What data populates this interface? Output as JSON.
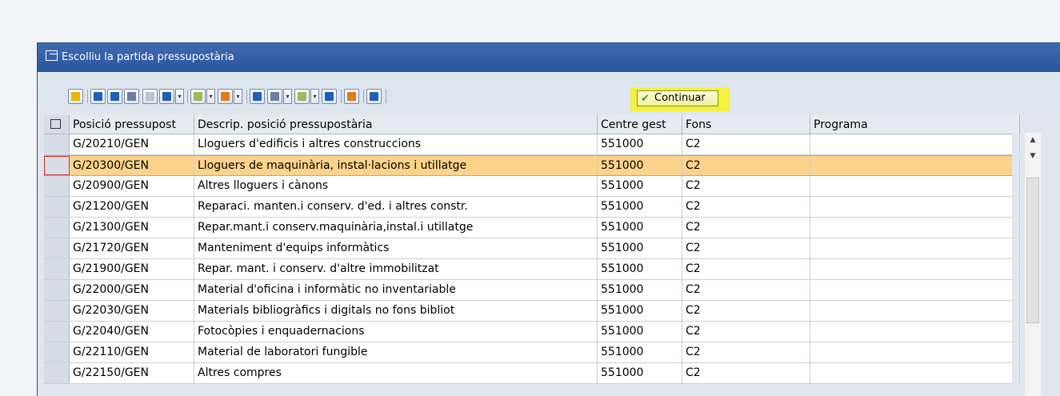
{
  "dialog": {
    "title": "Escolliu la partida pressupostària",
    "continue_label": "Continuar"
  },
  "columns": [
    "Posició pressupost",
    "Descrip. posició pressupostària",
    "Centre gest",
    "Fons",
    "Programa"
  ],
  "rows": [
    {
      "pos": "G/20210/GEN",
      "desc": "Lloguers d'edificis i altres construccions",
      "centre": "551000",
      "fons": "C2",
      "programa": ""
    },
    {
      "pos": "G/20300/GEN",
      "desc": "Lloguers de maquinària, instal·lacions i utillatge",
      "centre": "551000",
      "fons": "C2",
      "programa": ""
    },
    {
      "pos": "G/20900/GEN",
      "desc": "Altres lloguers i cànons",
      "centre": "551000",
      "fons": "C2",
      "programa": ""
    },
    {
      "pos": "G/21200/GEN",
      "desc": "Reparaci. manten.i conserv. d'ed. i altres constr.",
      "centre": "551000",
      "fons": "C2",
      "programa": ""
    },
    {
      "pos": "G/21300/GEN",
      "desc": "Repar.mant.i conserv.maquinària,instal.i utillatge",
      "centre": "551000",
      "fons": "C2",
      "programa": ""
    },
    {
      "pos": "G/21720/GEN",
      "desc": "Manteniment d'equips informàtics",
      "centre": "551000",
      "fons": "C2",
      "programa": ""
    },
    {
      "pos": "G/21900/GEN",
      "desc": "Repar. mant. i conserv. d'altre immobilitzat",
      "centre": "551000",
      "fons": "C2",
      "programa": ""
    },
    {
      "pos": "G/22000/GEN",
      "desc": "Material d'oficina i informàtic no inventariable",
      "centre": "551000",
      "fons": "C2",
      "programa": ""
    },
    {
      "pos": "G/22030/GEN",
      "desc": "Materials bibliogràfics i digitals no fons bibliot",
      "centre": "551000",
      "fons": "C2",
      "programa": ""
    },
    {
      "pos": "G/22040/GEN",
      "desc": "Fotocòpies i enquadernacions",
      "centre": "551000",
      "fons": "C2",
      "programa": ""
    },
    {
      "pos": "G/22110/GEN",
      "desc": "Material de laboratori fungible",
      "centre": "551000",
      "fons": "C2",
      "programa": ""
    },
    {
      "pos": "G/22150/GEN",
      "desc": "Altres compres",
      "centre": "551000",
      "fons": "C2",
      "programa": ""
    }
  ],
  "selected_row": 1,
  "colors": {
    "title_bar": "#2b55a0",
    "selected_row": "#fbd38a",
    "highlight": "#f3f23c"
  }
}
